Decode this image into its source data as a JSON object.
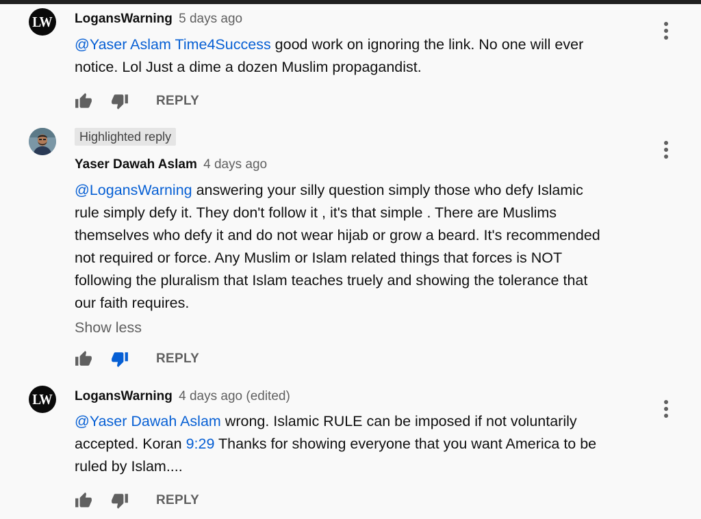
{
  "comments": [
    {
      "author": "LogansWarning",
      "time": "5 days ago",
      "avatar_initials": "LW",
      "mention": "@Yaser Aslam Time4Success",
      "body_line1_rest": " good work on ignoring the link. No one will ever",
      "body_line2": "notice. Lol Just a dime a dozen Muslim propagandist.",
      "reply_label": "REPLY"
    },
    {
      "badge": "Highlighted reply",
      "author": "Yaser Dawah Aslam",
      "time": "4 days ago",
      "mention": "@LogansWarning",
      "body_line1_rest": " answering your silly question simply those who defy Islamic",
      "body_lines": [
        "rule simply defy it. They don't follow it , it's that simple . There are Muslims",
        "themselves who defy it and do not wear hijab or grow a beard. It's recommended",
        "not required or force. Any Muslim or Islam related things that forces is NOT",
        "following the pluralism that Islam teaches truely and showing the tolerance that",
        "our faith requires."
      ],
      "show_less": "Show less",
      "reply_label": "REPLY",
      "disliked": true
    },
    {
      "author": "LogansWarning",
      "time": "4 days ago (edited)",
      "avatar_initials": "LW",
      "mention": "@Yaser Dawah Aslam",
      "body_line1_rest": " wrong. Islamic RULE can be imposed if not voluntarily",
      "body_line2_pre": "accepted. Koran ",
      "body_line2_link": "9:29",
      "body_line2_post": " Thanks for showing everyone that you want America to be",
      "body_line3": "ruled by Islam....",
      "reply_label": "REPLY"
    }
  ],
  "colors": {
    "link": "#065fd4",
    "secondary_text": "#606060",
    "background": "#f9f9f9",
    "active_dislike": "#065fd4"
  },
  "icons": [
    "thumbs-up-icon",
    "thumbs-down-icon",
    "more-vert-icon"
  ]
}
